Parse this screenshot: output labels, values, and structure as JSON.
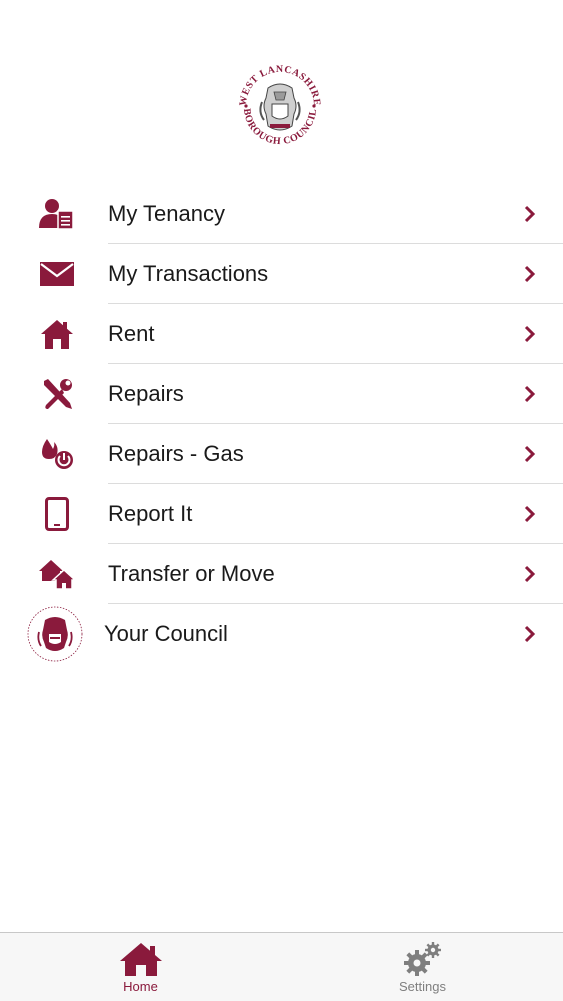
{
  "header": {
    "logo_text_top": "WEST LANCASHIRE",
    "logo_text_bottom": "BOROUGH COUNCIL"
  },
  "colors": {
    "accent": "#8a1a3c",
    "text": "#1a1a1a",
    "separator": "#dcdcdc",
    "inactive": "#7f7f7f"
  },
  "menu": {
    "items": [
      {
        "label": "My Tenancy",
        "icon": "tenant-document-icon"
      },
      {
        "label": "My Transactions",
        "icon": "envelope-icon"
      },
      {
        "label": "Rent",
        "icon": "house-icon"
      },
      {
        "label": "Repairs",
        "icon": "tools-icon"
      },
      {
        "label": "Repairs - Gas",
        "icon": "gas-flame-power-icon"
      },
      {
        "label": "Report It",
        "icon": "tablet-icon"
      },
      {
        "label": "Transfer or Move",
        "icon": "two-houses-icon"
      },
      {
        "label": "Your Council",
        "icon": "council-crest-icon"
      }
    ]
  },
  "tabbar": {
    "home_label": "Home",
    "settings_label": "Settings",
    "active": "home"
  }
}
